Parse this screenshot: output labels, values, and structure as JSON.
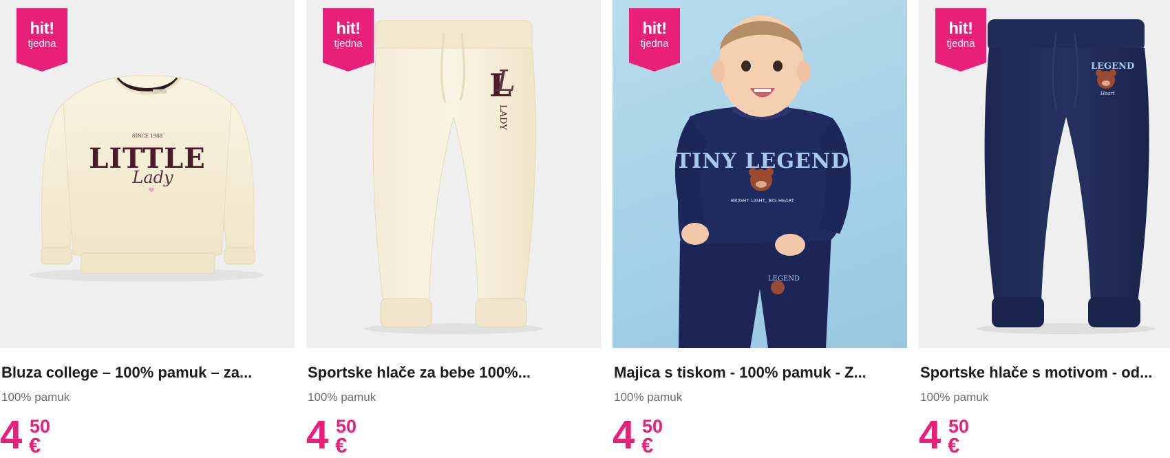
{
  "colors": {
    "accent": "#e8207a",
    "title": "#1b1b1b",
    "subtitle": "#6b6b6b"
  },
  "products": [
    {
      "badge": {
        "main": "hit!",
        "sub": "tjedna"
      },
      "image": {
        "icon": "sweatshirt-image",
        "print": [
          "LITTLE",
          "Lady",
          "SINCE 1988"
        ]
      },
      "title": "Bluza college – 100% pamuk – za...",
      "subtitle": "100% pamuk",
      "price": {
        "main": "4",
        "cents": "50",
        "currency": "€"
      }
    },
    {
      "badge": {
        "main": "hit!",
        "sub": "tjedna"
      },
      "image": {
        "icon": "jogger-pants-image",
        "print": [
          "L",
          "L",
          "LADY"
        ]
      },
      "title": "Sportske hlače za bebe 100%...",
      "subtitle": "100% pamuk",
      "price": {
        "main": "4",
        "cents": "50",
        "currency": "€"
      }
    },
    {
      "badge": {
        "main": "hit!",
        "sub": "tjedna"
      },
      "image": {
        "icon": "baby-photo-image",
        "print": [
          "TINY LEGEND",
          "BRIGHT LIGHT, BIG HEART",
          "LEGEND"
        ]
      },
      "title": "Majica s tiskom - 100% pamuk - Z...",
      "subtitle": "100% pamuk",
      "price": {
        "main": "4",
        "cents": "50",
        "currency": "€"
      }
    },
    {
      "badge": {
        "main": "hit!",
        "sub": "tjedna"
      },
      "image": {
        "icon": "navy-pants-image",
        "print": [
          "LEGEND",
          "Heart"
        ]
      },
      "title": "Sportske hlače s motivom - od...",
      "subtitle": "100% pamuk",
      "price": {
        "main": "4",
        "cents": "50",
        "currency": "€"
      }
    }
  ]
}
